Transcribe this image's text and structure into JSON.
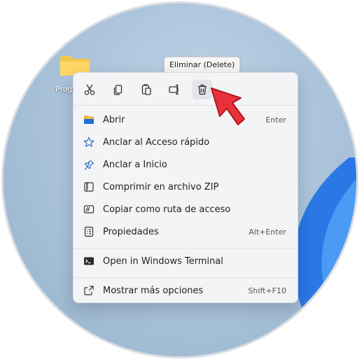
{
  "desktop": {
    "folder_label": "Progr"
  },
  "tooltip": "Eliminar (Delete)",
  "toolbar": [
    {
      "name": "cut-icon"
    },
    {
      "name": "copy-icon"
    },
    {
      "name": "paste-icon"
    },
    {
      "name": "rename-icon"
    },
    {
      "name": "delete-icon"
    }
  ],
  "menu": {
    "items": [
      {
        "label": "Abrir",
        "shortcut": "Enter",
        "icon": "folder-open-icon"
      },
      {
        "label": "Anclar al Acceso rápido",
        "shortcut": "",
        "icon": "star-icon"
      },
      {
        "label": "Anclar a Inicio",
        "shortcut": "",
        "icon": "pin-icon"
      },
      {
        "label": "Comprimir en archivo ZIP",
        "shortcut": "",
        "icon": "zip-icon"
      },
      {
        "label": "Copiar como ruta de acceso",
        "shortcut": "",
        "icon": "path-icon"
      },
      {
        "label": "Propiedades",
        "shortcut": "Alt+Enter",
        "icon": "properties-icon"
      },
      {
        "label": "Open in Windows Terminal",
        "shortcut": "",
        "icon": "terminal-icon"
      },
      {
        "label": "Mostrar más opciones",
        "shortcut": "Shift+F10",
        "icon": "more-options-icon"
      }
    ]
  },
  "colors": {
    "accent": "#0067c0",
    "pointer_arrow": "#e8313a",
    "menu_bg": "#f3f4f6"
  }
}
